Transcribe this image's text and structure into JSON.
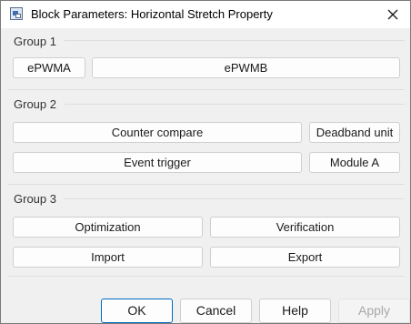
{
  "window": {
    "title": "Block Parameters: Horizontal Stretch Property",
    "close_icon": "close-icon",
    "app_icon": "simulink-block-icon"
  },
  "groups": [
    {
      "title": "Group 1",
      "buttons": [
        "ePWMA",
        "ePWMB"
      ]
    },
    {
      "title": "Group 2",
      "buttons": [
        "Counter compare",
        "Deadband unit",
        "Event trigger",
        "Module A"
      ]
    },
    {
      "title": "Group 3",
      "buttons": [
        "Optimization",
        "Verification",
        "Import",
        "Export"
      ]
    }
  ],
  "footer": {
    "ok": "OK",
    "cancel": "Cancel",
    "help": "Help",
    "apply": "Apply",
    "apply_enabled": false
  },
  "colors": {
    "accent": "#0067c0",
    "background": "#f0f0f0"
  }
}
